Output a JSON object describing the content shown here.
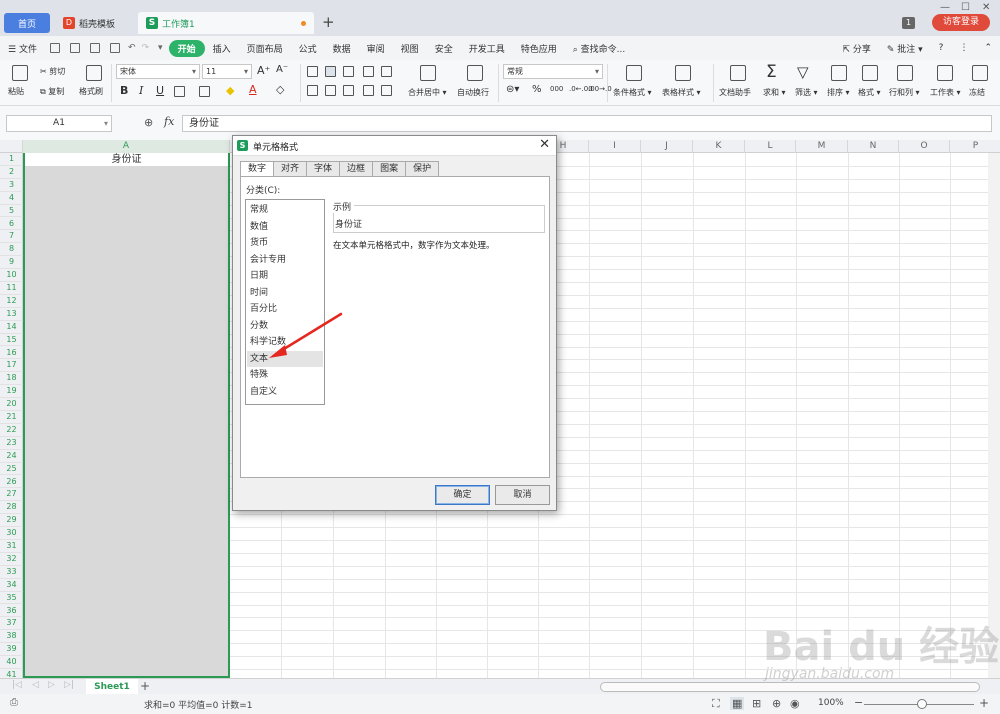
{
  "titlebar": {
    "tabs": [
      {
        "label": "首页"
      },
      {
        "label": "稻壳模板"
      },
      {
        "label": "工作簿1"
      }
    ],
    "window_count": "1",
    "login_label": "访客登录"
  },
  "menubar": {
    "file_label": "文件",
    "items": [
      "开始",
      "插入",
      "页面布局",
      "公式",
      "数据",
      "审阅",
      "视图",
      "安全",
      "开发工具",
      "特色应用"
    ],
    "search_label": "查找命令...",
    "share_label": "分享",
    "comment_label": "批注"
  },
  "ribbon": {
    "paste": "粘贴",
    "cut": "剪切",
    "copy": "复制",
    "format_painter": "格式刷",
    "font_name": "宋体",
    "font_size": "11",
    "number_format": "常规",
    "merge_center": "合并居中",
    "wrap_text": "自动换行",
    "conditional_format": "条件格式",
    "table_style": "表格样式",
    "doc_helper": "文档助手",
    "sum": "求和",
    "filter": "筛选",
    "sort": "排序",
    "format": "格式",
    "row_col": "行和列",
    "worksheet": "工作表",
    "freeze": "冻结",
    "percent": "%",
    "thousands": "000",
    "dec_inc": ".0←.00",
    "dec_dec": ".00→.0"
  },
  "formulabar": {
    "namebox": "A1",
    "fx": "fx",
    "value": "身份证"
  },
  "grid": {
    "columns": [
      "A",
      "H",
      "I",
      "J",
      "K",
      "L",
      "M",
      "N",
      "O",
      "P"
    ],
    "rows": [
      "1",
      "2",
      "3",
      "4",
      "5",
      "6",
      "7",
      "8",
      "9",
      "10",
      "11",
      "12",
      "13",
      "14",
      "15",
      "16",
      "17",
      "18",
      "19",
      "20",
      "21",
      "22",
      "23",
      "24",
      "25",
      "26",
      "27",
      "28",
      "29",
      "30",
      "31",
      "32",
      "33",
      "34",
      "35",
      "36",
      "37",
      "38",
      "39",
      "40",
      "41"
    ],
    "a1": "身份证"
  },
  "sheetbar": {
    "sheet_name": "Sheet1",
    "add": "+"
  },
  "statusbar": {
    "summary": "求和=0  平均值=0  计数=1",
    "zoom": "100%"
  },
  "dialog": {
    "title": "单元格格式",
    "tabs": [
      "数字",
      "对齐",
      "字体",
      "边框",
      "图案",
      "保护"
    ],
    "category_label": "分类(C):",
    "categories": [
      "常规",
      "数值",
      "货币",
      "会计专用",
      "日期",
      "时间",
      "百分比",
      "分数",
      "科学记数",
      "文本",
      "特殊",
      "自定义"
    ],
    "selected_category": "文本",
    "sample_label": "示例",
    "sample_value": "身份证",
    "description": "在文本单元格格式中，数字作为文本处理。",
    "ok_label": "确定",
    "cancel_label": "取消"
  },
  "watermark": {
    "text": "Bai du 经验",
    "url": "jingyan.baidu.com"
  }
}
